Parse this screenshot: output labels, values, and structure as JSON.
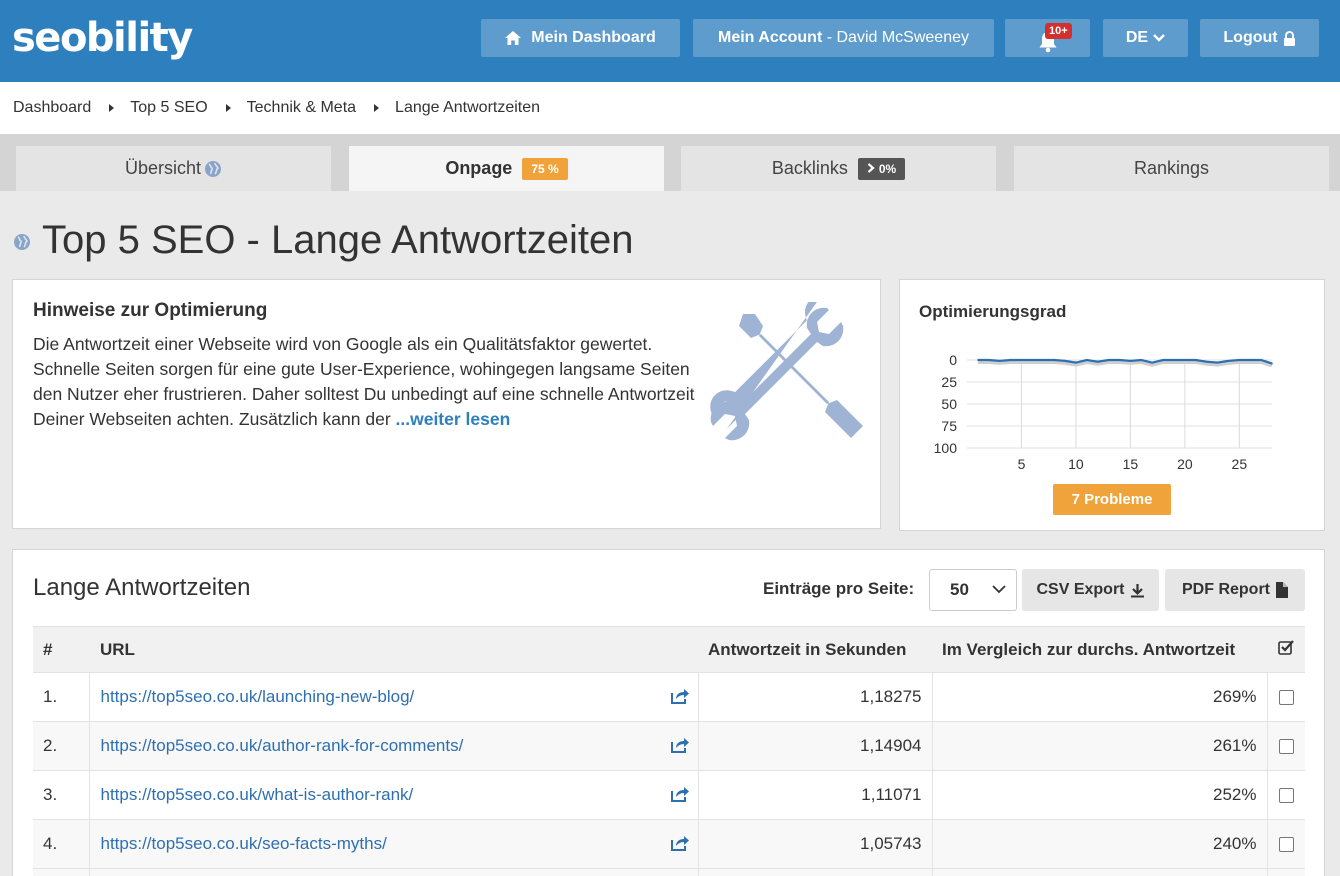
{
  "header": {
    "logo": "seobility",
    "dashboard_label": "Mein Dashboard",
    "account_label": "Mein Account",
    "account_sep": " - ",
    "account_user": "David McSweeney",
    "notif_badge": "10+",
    "lang_label": "DE",
    "logout_label": "Logout"
  },
  "breadcrumb": [
    "Dashboard",
    "Top 5 SEO",
    "Technik & Meta",
    "Lange Antwortzeiten"
  ],
  "tabs": [
    {
      "label": "Übersicht"
    },
    {
      "label": "Onpage",
      "pill": "75 %"
    },
    {
      "label": "Backlinks",
      "pill": "0%"
    },
    {
      "label": "Rankings"
    }
  ],
  "page_title": "Top 5 SEO - Lange Antwortzeiten",
  "hints": {
    "title": "Hinweise zur Optimierung",
    "text": "Die Antwortzeit einer Webseite wird von Google als ein Qualitätsfaktor gewertet. Schnelle Seiten sorgen für eine gute User-Experience, wohingegen langsame Seiten den Nutzer eher frustrieren. Daher solltest Du unbedingt auf eine schnelle Antwortzeit Deiner Webseiten achten. Zusätzlich kann der ",
    "more_link": "...weiter lesen"
  },
  "optimization": {
    "title": "Optimierungsgrad",
    "problems_label": "7 Probleme"
  },
  "chart_data": {
    "type": "line",
    "x": [
      1,
      2,
      3,
      4,
      5,
      6,
      7,
      8,
      9,
      10,
      11,
      12,
      13,
      14,
      15,
      16,
      17,
      18,
      19,
      20,
      21,
      22,
      23,
      24,
      25,
      26,
      27,
      28
    ],
    "values": [
      0,
      0,
      1,
      0,
      0,
      0,
      0,
      0,
      1,
      3,
      0,
      2,
      0,
      0,
      1,
      0,
      3,
      0,
      0,
      0,
      0,
      2,
      3,
      1,
      0,
      0,
      0,
      4
    ],
    "ylim": [
      0,
      100
    ],
    "y_inverted": true,
    "yticks": [
      "0",
      "25",
      "50",
      "75",
      "100"
    ],
    "xticks": [
      "5",
      "10",
      "15",
      "20",
      "25"
    ],
    "colors": {
      "line": "#2e6fb0"
    }
  },
  "table": {
    "title": "Lange Antwortzeiten",
    "per_page_label": "Einträge pro Seite:",
    "per_page_value": "50",
    "csv_label": "CSV Export",
    "pdf_label": "PDF Report",
    "columns": [
      "#",
      "URL",
      "Antwortzeit in Sekunden",
      "Im Vergleich zur durchs. Antwortzeit"
    ],
    "rows": [
      {
        "num": "1.",
        "url": "https://top5seo.co.uk/launching-new-blog/",
        "seconds": "1,18275",
        "pct": "269%"
      },
      {
        "num": "2.",
        "url": "https://top5seo.co.uk/author-rank-for-comments/",
        "seconds": "1,14904",
        "pct": "261%"
      },
      {
        "num": "3.",
        "url": "https://top5seo.co.uk/what-is-author-rank/",
        "seconds": "1,11071",
        "pct": "252%"
      },
      {
        "num": "4.",
        "url": "https://top5seo.co.uk/seo-facts-myths/",
        "seconds": "1,05743",
        "pct": "240%"
      }
    ]
  },
  "colors": {
    "brand": "#2e7fbd",
    "accent": "#f0a33a"
  }
}
